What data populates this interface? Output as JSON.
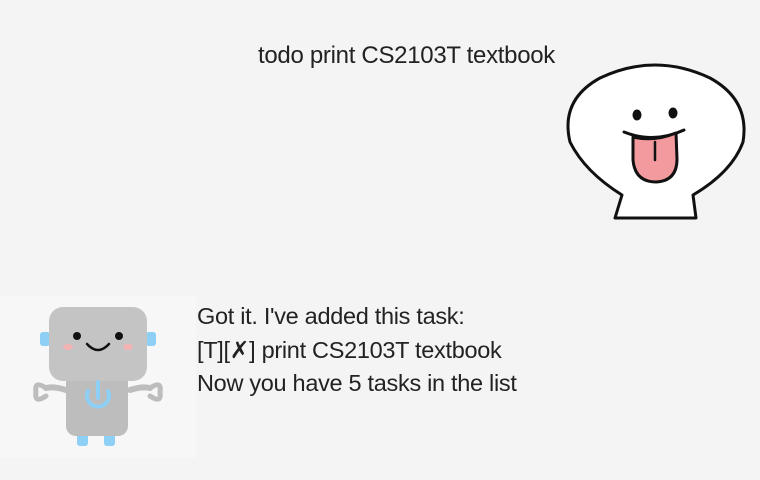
{
  "user_message": {
    "text": "todo print CS2103T textbook",
    "avatar_icon": "smiling-face-tongue-out-icon"
  },
  "bot_message": {
    "lines": [
      "Got it. I've added this task:",
      "[T][✗] print CS2103T textbook",
      "Now you have 5 tasks in the list"
    ],
    "avatar_icon": "robot-icon"
  },
  "colors": {
    "background": "#f4f4f4",
    "robot_body": "#bdbdbd",
    "robot_accent": "#8ecff5",
    "tongue": "#f39a9f"
  }
}
